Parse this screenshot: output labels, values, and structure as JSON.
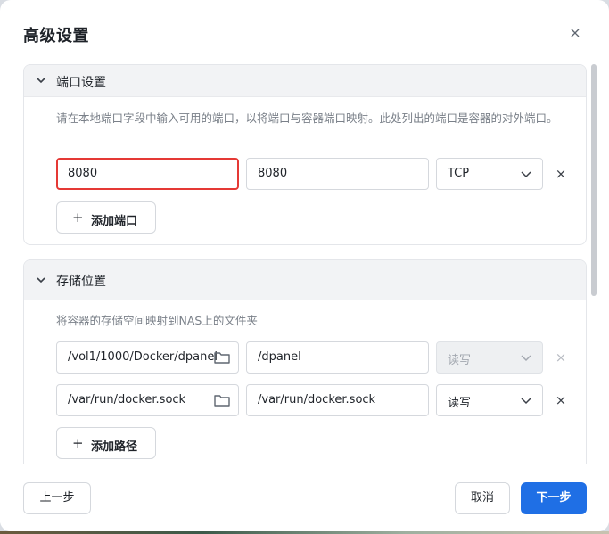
{
  "dialog": {
    "title": "高级设置",
    "close_label": "×"
  },
  "ports": {
    "title": "端口设置",
    "description": "请在本地端口字段中输入可用的端口，以将端口与容器端口映射。此处列出的端口是容器的对外端口。",
    "rows": [
      {
        "local_port": "8080",
        "container_port": "8080",
        "protocol": "TCP"
      }
    ],
    "add_label": "添加端口",
    "remove_label": "×"
  },
  "storage": {
    "title": "存储位置",
    "description": "将容器的存储空间映射到NAS上的文件夹",
    "rows": [
      {
        "host_path": "/vol1/1000/Docker/dpanel",
        "container_path": "/dpanel",
        "mode": "读写",
        "disabled": true
      },
      {
        "host_path": "/var/run/docker.sock",
        "container_path": "/var/run/docker.sock",
        "mode": "读写",
        "disabled": false
      }
    ],
    "add_label": "添加路径",
    "remove_label": "×"
  },
  "footer": {
    "prev_label": "上一步",
    "cancel_label": "取消",
    "next_label": "下一步"
  },
  "colors": {
    "primary": "#1f6fe5",
    "highlight_border": "#e53935"
  }
}
